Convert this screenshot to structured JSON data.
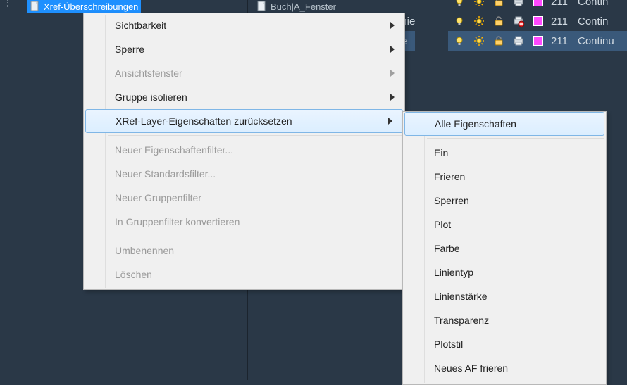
{
  "tree": {
    "item_selected": "Xref-Überschreibungen",
    "item_other": "Buch|A_Fenster"
  },
  "layer_labels": [
    "inie",
    "te"
  ],
  "layers": [
    {
      "color_index": "211",
      "linetype": "Contin",
      "swatch": "#ff49ff",
      "highlight": false
    },
    {
      "color_index": "211",
      "linetype": "Contin",
      "swatch": "#ff49ff",
      "highlight": false
    },
    {
      "color_index": "211",
      "linetype": "Continu",
      "swatch": "#ff49ff",
      "highlight": true
    }
  ],
  "context_menu": {
    "groups": [
      [
        {
          "label": "Sichtbarkeit",
          "arrow": true,
          "enabled": true
        },
        {
          "label": "Sperre",
          "arrow": true,
          "enabled": true
        },
        {
          "label": "Ansichtsfenster",
          "arrow": true,
          "enabled": false
        },
        {
          "label": "Gruppe isolieren",
          "arrow": true,
          "enabled": true
        },
        {
          "label": "XRef-Layer-Eigenschaften zurücksetzen",
          "arrow": true,
          "enabled": true,
          "active": true
        }
      ],
      [
        {
          "label": "Neuer Eigenschaftenfilter...",
          "arrow": false,
          "enabled": false
        },
        {
          "label": "Neuer Standardsfilter...",
          "arrow": false,
          "enabled": false
        },
        {
          "label": "Neuer Gruppenfilter",
          "arrow": false,
          "enabled": false
        },
        {
          "label": "In Gruppenfilter konvertieren",
          "arrow": false,
          "enabled": false
        }
      ],
      [
        {
          "label": "Umbenennen",
          "arrow": false,
          "enabled": false
        },
        {
          "label": "Löschen",
          "arrow": false,
          "enabled": false
        }
      ]
    ]
  },
  "submenu": {
    "groups": [
      [
        {
          "label": "Alle Eigenschaften",
          "active": true
        }
      ],
      [
        {
          "label": "Ein"
        },
        {
          "label": "Frieren"
        },
        {
          "label": "Sperren"
        },
        {
          "label": "Plot"
        },
        {
          "label": "Farbe"
        },
        {
          "label": "Linientyp"
        },
        {
          "label": "Linienstärke"
        },
        {
          "label": "Transparenz"
        },
        {
          "label": "Plotstil"
        },
        {
          "label": "Neues AF frieren"
        }
      ]
    ]
  }
}
